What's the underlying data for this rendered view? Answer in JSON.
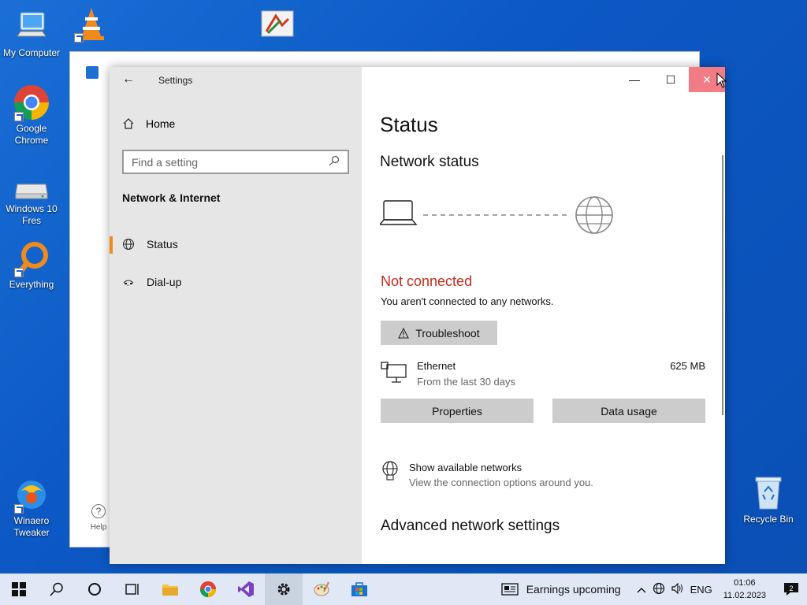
{
  "desktop": {
    "icons": [
      {
        "label": "My Computer"
      },
      {
        "label": "VLC media"
      },
      {
        "label": "TERC"
      },
      {
        "label": "Google Chrome"
      },
      {
        "label": "Windows 10 Fres"
      },
      {
        "label": "Everything"
      },
      {
        "label": "Winaero Tweaker"
      },
      {
        "label": "Recycle Bin"
      }
    ]
  },
  "back_window": {
    "help_label": "Help"
  },
  "settings": {
    "app_title": "Settings",
    "home_label": "Home",
    "search_placeholder": "Find a setting",
    "section_title": "Network & Internet",
    "nav": [
      {
        "label": "Status",
        "icon": "globe-icon",
        "active": true
      },
      {
        "label": "Dial-up",
        "icon": "dialup-icon",
        "active": false
      }
    ],
    "content": {
      "title": "Status",
      "network_status_heading": "Network status",
      "state": "Not connected",
      "state_description": "You aren't connected to any networks.",
      "troubleshoot_label": "Troubleshoot",
      "ethernet": {
        "name": "Ethernet",
        "period": "From the last 30 days",
        "usage": "625 MB"
      },
      "properties_label": "Properties",
      "data_usage_label": "Data usage",
      "show_networks": {
        "title": "Show available networks",
        "subtitle": "View the connection options around you."
      },
      "advanced_heading": "Advanced network settings"
    },
    "colors": {
      "accent": "#f08a1c",
      "error": "#c42b1c"
    }
  },
  "taskbar": {
    "news": "Earnings upcoming",
    "language": "ENG",
    "time": "01:06",
    "date": "11.02.2023",
    "notification_count": "2"
  }
}
